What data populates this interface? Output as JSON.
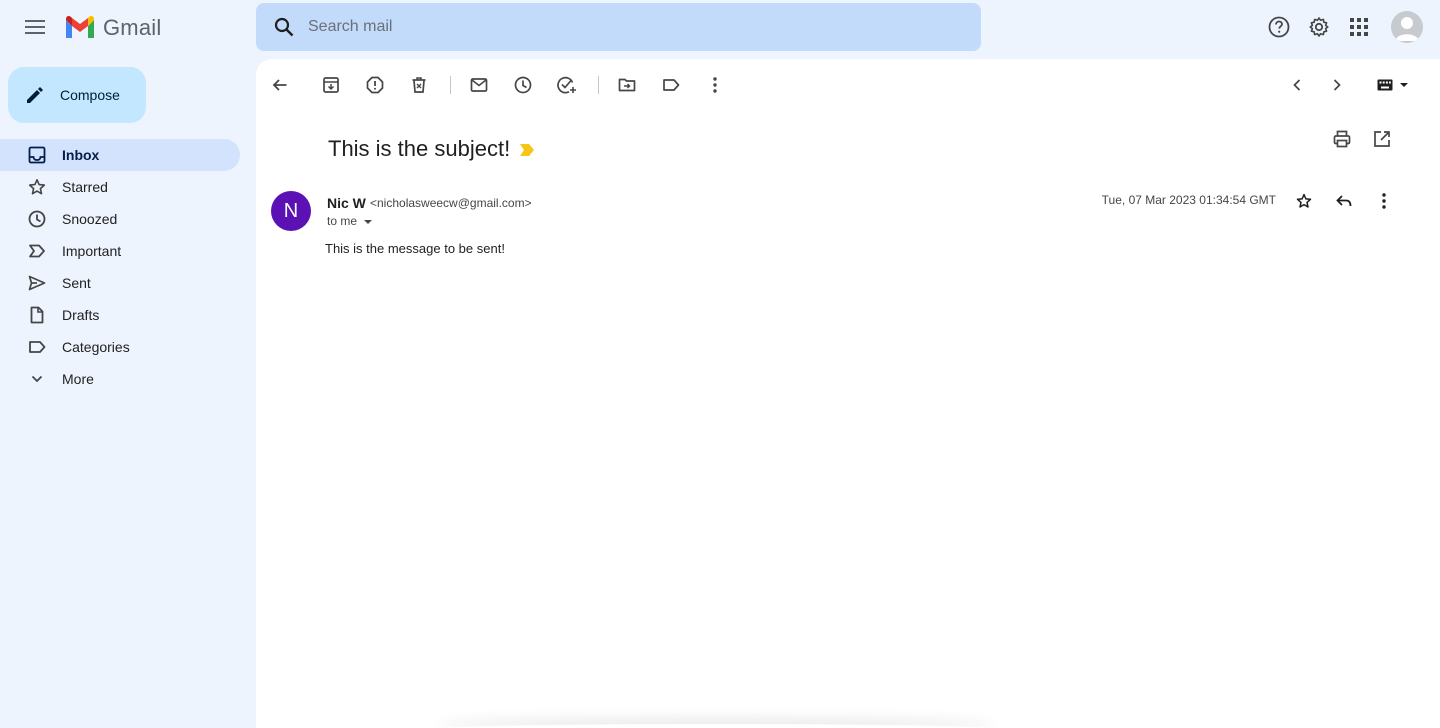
{
  "app": {
    "name": "Gmail"
  },
  "search": {
    "placeholder": "Search mail"
  },
  "compose": {
    "label": "Compose"
  },
  "sidebar": {
    "items": [
      {
        "label": "Inbox",
        "icon": "inbox-icon",
        "active": true
      },
      {
        "label": "Starred",
        "icon": "star-icon"
      },
      {
        "label": "Snoozed",
        "icon": "clock-icon"
      },
      {
        "label": "Important",
        "icon": "important-icon"
      },
      {
        "label": "Sent",
        "icon": "send-icon"
      },
      {
        "label": "Drafts",
        "icon": "draft-icon"
      },
      {
        "label": "Categories",
        "icon": "label-icon"
      },
      {
        "label": "More",
        "icon": "chevron-down-icon"
      }
    ]
  },
  "toolbar": {
    "actions": [
      "back",
      "archive",
      "report-spam",
      "delete",
      "mark-unread",
      "snooze",
      "add-to-tasks",
      "move-to",
      "labels",
      "more"
    ]
  },
  "email": {
    "subject": "This is the subject!",
    "sender_initial": "N",
    "sender_name": "Nic W",
    "sender_email": "<nicholasweecw@gmail.com>",
    "to": "to me",
    "date": "Tue, 07 Mar 2023 01:34:54 GMT",
    "body": "This is the message to be sent!"
  },
  "colors": {
    "background": "#eef4fd",
    "search_bg": "#c2dbfb",
    "compose_bg": "#c2e7ff",
    "active_nav": "#d3e3fd",
    "avatar": "#5b11b3",
    "important": "#f5c518"
  }
}
